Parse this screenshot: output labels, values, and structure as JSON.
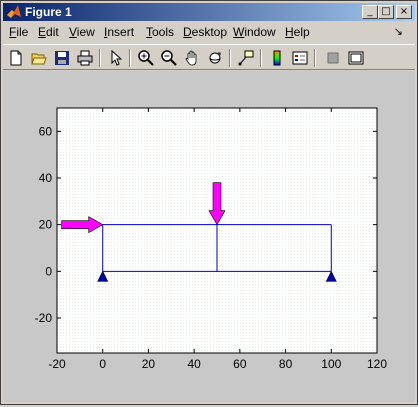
{
  "window": {
    "title": "Figure 1"
  },
  "title_buttons": {
    "minimize": "_",
    "maximize": "□",
    "close": "×"
  },
  "menu": [
    {
      "label": "File",
      "key": "F",
      "rest": "ile"
    },
    {
      "label": "Edit",
      "key": "E",
      "rest": "dit"
    },
    {
      "label": "View",
      "key": "V",
      "rest": "iew"
    },
    {
      "label": "Insert",
      "key": "I",
      "rest": "nsert"
    },
    {
      "label": "Tools",
      "key": "T",
      "rest": "ools"
    },
    {
      "label": "Desktop",
      "key": "D",
      "rest": "esktop"
    },
    {
      "label": "Window",
      "key": "W",
      "rest": "indow"
    },
    {
      "label": "Help",
      "key": "H",
      "rest": "elp"
    }
  ],
  "menu_arrow": "↘",
  "toolbar_icons": [
    "new-figure-icon",
    "open-file-icon",
    "save-icon",
    "print-icon",
    "edit-plot-arrow-icon",
    "zoom-in-icon",
    "zoom-out-icon",
    "pan-hand-icon",
    "rotate-3d-icon",
    "data-cursor-icon",
    "colorbar-icon",
    "legend-icon",
    "hide-plot-tools-icon",
    "show-plot-tools-icon"
  ],
  "chart_data": {
    "type": "line",
    "title": "",
    "xlabel": "",
    "ylabel": "",
    "xlim": [
      -20,
      120
    ],
    "ylim": [
      -35,
      70
    ],
    "xticks": [
      -20,
      0,
      20,
      40,
      60,
      80,
      100,
      120
    ],
    "yticks": [
      -20,
      0,
      20,
      40,
      60
    ],
    "grid": false,
    "colors": {
      "structure": "#0000cc",
      "load_arrow": "#ff00ff",
      "support": "#0000aa",
      "background": "#ffffff",
      "axes": "#000000"
    },
    "structure_lines": [
      {
        "x": [
          0,
          100
        ],
        "y": [
          0,
          0
        ]
      },
      {
        "x": [
          0,
          100
        ],
        "y": [
          20,
          20
        ]
      },
      {
        "x": [
          0,
          0
        ],
        "y": [
          0,
          20
        ]
      },
      {
        "x": [
          50,
          50
        ],
        "y": [
          0,
          20
        ]
      },
      {
        "x": [
          100,
          100
        ],
        "y": [
          0,
          20
        ]
      }
    ],
    "loads": [
      {
        "direction": "right",
        "x_start": -18,
        "x_end": 0,
        "y": 20
      },
      {
        "direction": "down",
        "x": 50,
        "y_start": 38,
        "y_end": 20
      }
    ],
    "supports": [
      {
        "x": 0,
        "y": 0
      },
      {
        "x": 100,
        "y": 0
      }
    ]
  }
}
